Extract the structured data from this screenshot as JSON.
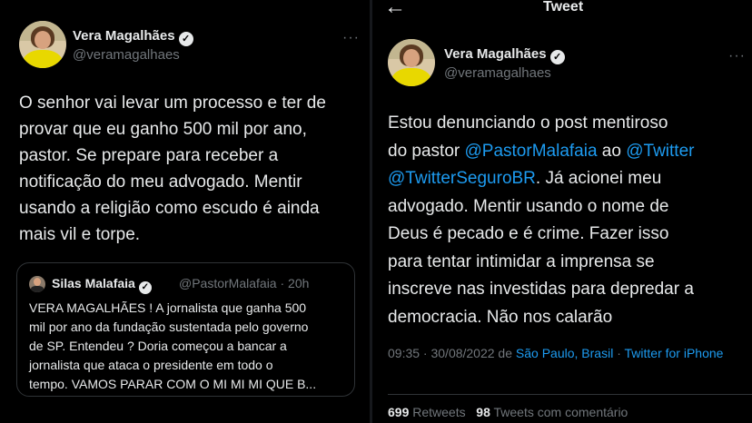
{
  "left_tweet": {
    "author_name": "Vera Magalhães",
    "author_handle": "@veramagalhaes",
    "verified_mark": "✓",
    "more_label": "···",
    "text_lines": [
      "O senhor vai levar um processo e ter de",
      "provar que eu ganho 500 mil por ano,",
      "pastor. Se prepare para receber a",
      "notificação do meu advogado. Mentir",
      "usando a religião como escudo é ainda",
      "mais vil e torpe."
    ],
    "quote": {
      "author_name": "Silas Malafaia",
      "author_handle": "@PastorMalafaia · 20h",
      "text_lines": [
        "VERA MAGALHÃES ! A jornalista que ganha 500",
        "mil por ano da fundação sustentada pelo governo",
        "de SP. Entendeu ? Doria começou a bancar a",
        "jornalista que ataca o presidente em todo o",
        "tempo. VAMOS PARAR COM O MI MI MI QUE B..."
      ]
    }
  },
  "right_tweet": {
    "header": {
      "back_icon": "←",
      "title": "Tweet"
    },
    "author_name": "Vera Magalhães",
    "author_handle": "@veramagalhaes",
    "verified_mark": "✓",
    "more_label": "···",
    "text": {
      "l1": "Estou denunciando o post mentiroso",
      "l2_pre": "do pastor ",
      "l2_mention1": "@PastorMalafaia",
      "l2_mid": " ao ",
      "l2_mention2": "@Twitter",
      "l3_mention": "@TwitterSeguroBR",
      "l3_post": ". Já acionei meu",
      "l4": "advogado. Mentir usando o nome de",
      "l5": "Deus é pecado e é crime. Fazer isso",
      "l6": "para tentar intimidar a imprensa se",
      "l7": "inscreve nas investidas para depredar a",
      "l8": "democracia. Não nos calarão"
    },
    "meta": {
      "time_date": "09:35 · 30/08/2022 de ",
      "location": "São Paulo, Brasil",
      "separator": " · ",
      "client": "Twitter for iPhone"
    },
    "stats": {
      "retweets_count": "699",
      "retweets_label": "Retweets",
      "quotes_count": "98",
      "quotes_label": "Tweets com comentário"
    }
  },
  "colors": {
    "background": "#000000",
    "link": "#1d9bf0",
    "muted": "#71767b",
    "text": "#e7e9ea"
  }
}
